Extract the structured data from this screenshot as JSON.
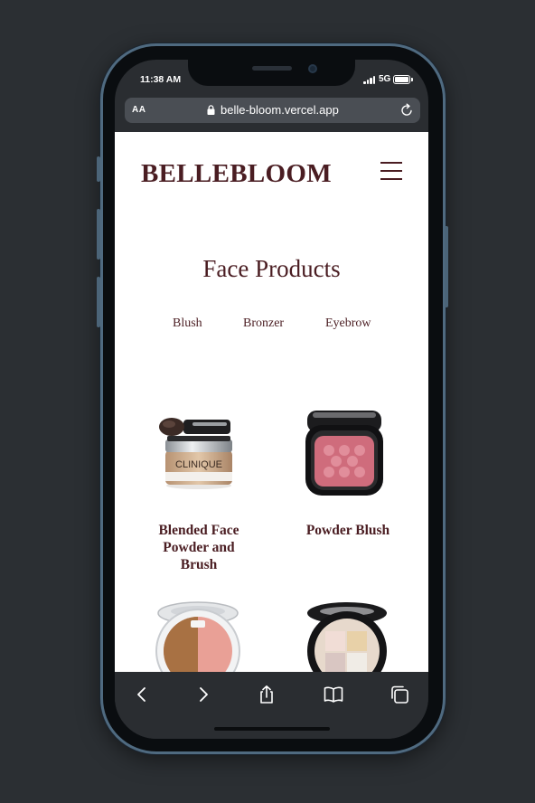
{
  "status_bar": {
    "time": "11:38 AM",
    "network": "5G"
  },
  "browser": {
    "aa_label": "AA",
    "url": "belle-bloom.vercel.app"
  },
  "header": {
    "logo": "BELLEBLOOM"
  },
  "main": {
    "title": "Face Products",
    "categories": [
      "Blush",
      "Bronzer",
      "Eyebrow"
    ],
    "products": [
      {
        "name_lines": [
          "Blended Face",
          "Powder and",
          "Brush"
        ]
      },
      {
        "name_lines": [
          "Powder Blush"
        ]
      },
      {
        "name_lines": []
      },
      {
        "name_lines": []
      }
    ]
  },
  "images": {
    "product_1_label": "CLINIQUE"
  },
  "colors": {
    "brand": "#4a1d22",
    "page_bg": "#ffffff",
    "frame": "#4f6a80"
  }
}
